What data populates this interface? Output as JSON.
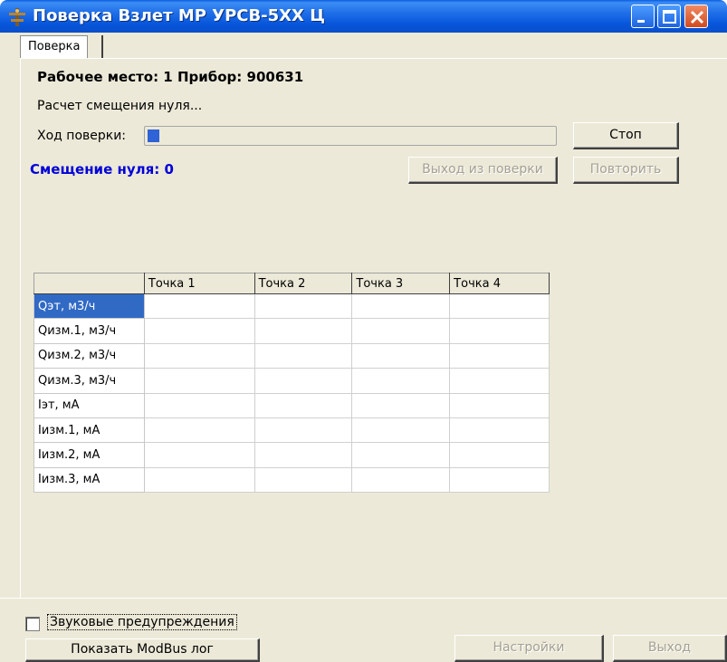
{
  "window": {
    "title": "Поверка Взлет МР УРСВ-5ХХ Ц",
    "icon": "app-logo-icon"
  },
  "tabs": [
    {
      "label": "Поверка",
      "active": true
    }
  ],
  "main": {
    "workplace": "Рабочее место: 1  Прибор: 900631",
    "status": "Расчет смещения нуля...",
    "progress_label": "Ход поверки:",
    "progress_value": 0.03,
    "zero_offset": "Смещение нуля: 0",
    "zero_color": "#0000d8",
    "buttons": {
      "stop": "Стоп",
      "exit_verification": "Выход из поверки",
      "repeat": "Повторить"
    }
  },
  "grid": {
    "columns": [
      "",
      "Точка 1",
      "Точка 2",
      "Точка 3",
      "Точка 4"
    ],
    "rows": [
      {
        "label": "Qэт, м3/ч",
        "selected": true
      },
      {
        "label": "Qизм.1, м3/ч"
      },
      {
        "label": "Qизм.2, м3/ч"
      },
      {
        "label": "Qизм.3, м3/ч"
      },
      {
        "label": "Iэт, мА"
      },
      {
        "label": "Iизм.1, мА"
      },
      {
        "label": "Iизм.2, мА"
      },
      {
        "label": "Iизм.3, мА"
      }
    ]
  },
  "footer": {
    "sound_warnings": "Звуковые предупреждения",
    "sound_warnings_checked": false,
    "show_modbus_log": "Показать ModBus лог",
    "settings": "Настройки",
    "exit": "Выход"
  }
}
